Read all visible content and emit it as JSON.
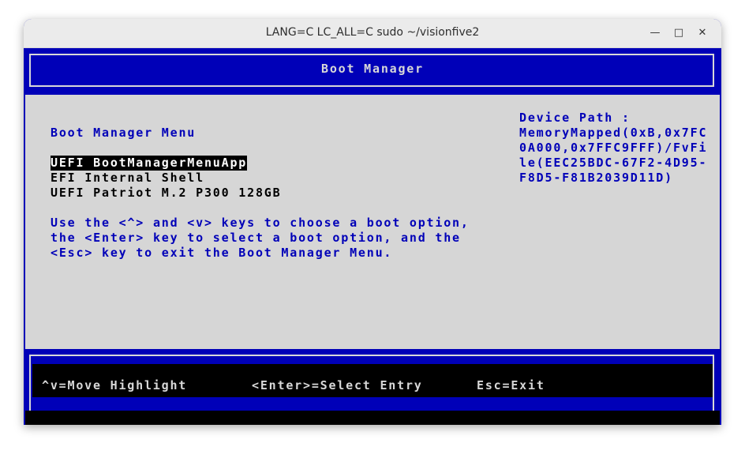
{
  "window": {
    "title": "LANG=C LC_ALL=C sudo ~/visionfive2",
    "minimize_glyph": "—",
    "maximize_glyph": "□",
    "close_glyph": "✕"
  },
  "header": {
    "title": "Boot Manager"
  },
  "menu": {
    "title": "Boot Manager Menu",
    "items": [
      {
        "label": "UEFI BootManagerMenuApp",
        "selected": true
      },
      {
        "label": "EFI Internal Shell",
        "selected": false
      },
      {
        "label": "UEFI Patriot M.2 P300 128GB",
        "selected": false
      }
    ],
    "help_lines": [
      "Use the <^> and <v> keys to choose a boot option,",
      "the <Enter> key to select a boot option, and the",
      "<Esc> key to exit the Boot Manager Menu."
    ]
  },
  "device_path": {
    "lines": [
      "Device Path :",
      "MemoryMapped(0xB,0x7FC",
      "0A000,0x7FFC9FFF)/FvFi",
      "le(EEC25BDC-67F2-4D95-",
      "F8D5-F81B2039D11D)"
    ]
  },
  "footer": {
    "move": "^v=Move Highlight",
    "select": "<Enter>=Select Entry",
    "exit": "Esc=Exit"
  },
  "colors": {
    "terminal_blue": "#0000b8",
    "terminal_gray": "#d6d6d6",
    "highlight_bg": "#000000",
    "highlight_fg": "#ffffff"
  }
}
